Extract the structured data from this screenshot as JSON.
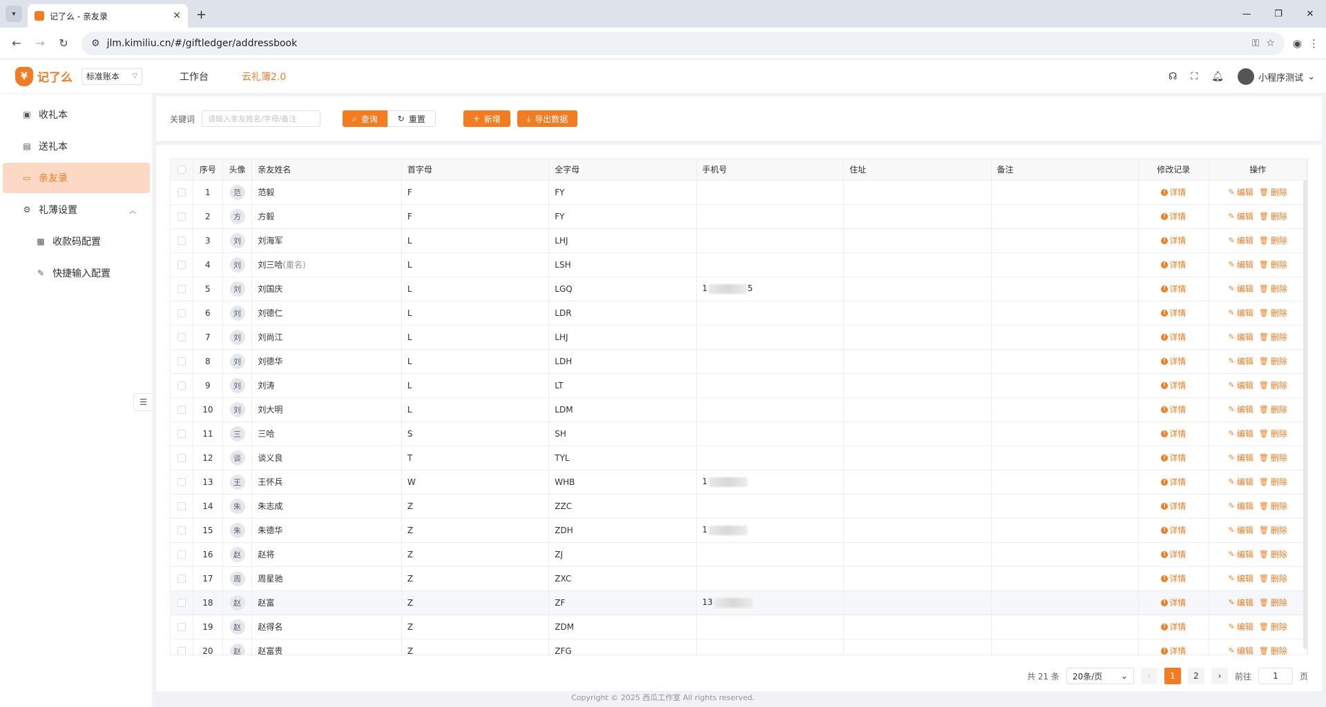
{
  "browser": {
    "tab_title": "记了么 - 亲友录",
    "url": "jlm.kimiliu.cn/#/giftledger/addressbook"
  },
  "app": {
    "logo_text": "记了么",
    "ledger_select": "标准账本",
    "nav": [
      "工作台",
      "云礼簿2.0"
    ],
    "user_name": "小程序测试"
  },
  "sidebar": {
    "items": [
      {
        "label": "收礼本",
        "icon": "book-icon"
      },
      {
        "label": "送礼本",
        "icon": "book-icon"
      },
      {
        "label": "亲友录",
        "icon": "folder-icon"
      },
      {
        "label": "礼薄设置",
        "icon": "gear-icon"
      },
      {
        "label": "收款码配置",
        "icon": "qrcode-icon"
      },
      {
        "label": "快捷输入配置",
        "icon": "edit-icon"
      }
    ]
  },
  "search": {
    "keyword_label": "关键词",
    "keyword_placeholder": "请输入亲友姓名/字母/备注",
    "query_btn": "查询",
    "reset_btn": "重置",
    "add_btn": "新增",
    "export_btn": "导出数据"
  },
  "table": {
    "headers": [
      "序号",
      "头像",
      "亲友姓名",
      "首字母",
      "全字母",
      "手机号",
      "住址",
      "备注",
      "修改记录",
      "操作"
    ],
    "detail_label": "详情",
    "edit_label": "编辑",
    "delete_label": "删除",
    "rows": [
      {
        "no": "1",
        "avatar": "范",
        "name": "范毅",
        "dup": "",
        "initial": "F",
        "full": "FY",
        "phone": ""
      },
      {
        "no": "2",
        "avatar": "方",
        "name": "方毅",
        "dup": "",
        "initial": "F",
        "full": "FY",
        "phone": ""
      },
      {
        "no": "3",
        "avatar": "刘",
        "name": "刘海军",
        "dup": "",
        "initial": "L",
        "full": "LHJ",
        "phone": ""
      },
      {
        "no": "4",
        "avatar": "刘",
        "name": "刘三哈",
        "dup": "(重名)",
        "initial": "L",
        "full": "LSH",
        "phone": ""
      },
      {
        "no": "5",
        "avatar": "刘",
        "name": "刘国庆",
        "dup": "",
        "initial": "L",
        "full": "LGQ",
        "phone": "1",
        "phone_tail": "5"
      },
      {
        "no": "6",
        "avatar": "刘",
        "name": "刘德仁",
        "dup": "",
        "initial": "L",
        "full": "LDR",
        "phone": ""
      },
      {
        "no": "7",
        "avatar": "刘",
        "name": "刘尚江",
        "dup": "",
        "initial": "L",
        "full": "LHJ",
        "phone": ""
      },
      {
        "no": "8",
        "avatar": "刘",
        "name": "刘德华",
        "dup": "",
        "initial": "L",
        "full": "LDH",
        "phone": ""
      },
      {
        "no": "9",
        "avatar": "刘",
        "name": "刘涛",
        "dup": "",
        "initial": "L",
        "full": "LT",
        "phone": ""
      },
      {
        "no": "10",
        "avatar": "刘",
        "name": "刘大明",
        "dup": "",
        "initial": "L",
        "full": "LDM",
        "phone": ""
      },
      {
        "no": "11",
        "avatar": "三",
        "name": "三哈",
        "dup": "",
        "initial": "S",
        "full": "SH",
        "phone": ""
      },
      {
        "no": "12",
        "avatar": "谈",
        "name": "谈义良",
        "dup": "",
        "initial": "T",
        "full": "TYL",
        "phone": ""
      },
      {
        "no": "13",
        "avatar": "王",
        "name": "王怀兵",
        "dup": "",
        "initial": "W",
        "full": "WHB",
        "phone": "1",
        "phone_tail": ""
      },
      {
        "no": "14",
        "avatar": "朱",
        "name": "朱志成",
        "dup": "",
        "initial": "Z",
        "full": "ZZC",
        "phone": ""
      },
      {
        "no": "15",
        "avatar": "朱",
        "name": "朱德华",
        "dup": "",
        "initial": "Z",
        "full": "ZDH",
        "phone": "1",
        "phone_tail": ""
      },
      {
        "no": "16",
        "avatar": "赵",
        "name": "赵将",
        "dup": "",
        "initial": "Z",
        "full": "ZJ",
        "phone": ""
      },
      {
        "no": "17",
        "avatar": "周",
        "name": "周星驰",
        "dup": "",
        "initial": "Z",
        "full": "ZXC",
        "phone": ""
      },
      {
        "no": "18",
        "avatar": "赵",
        "name": "赵富",
        "dup": "",
        "initial": "Z",
        "full": "ZF",
        "phone": "13",
        "phone_tail": ""
      },
      {
        "no": "19",
        "avatar": "赵",
        "name": "赵得名",
        "dup": "",
        "initial": "Z",
        "full": "ZDM",
        "phone": ""
      },
      {
        "no": "20",
        "avatar": "赵",
        "name": "赵富贵",
        "dup": "",
        "initial": "Z",
        "full": "ZFG",
        "phone": ""
      }
    ]
  },
  "pagination": {
    "total": "共 21 条",
    "page_size": "20条/页",
    "pages": [
      "1",
      "2"
    ],
    "current": "1",
    "goto_label": "前往",
    "goto_value": "1",
    "page_suffix": "页"
  },
  "footer": "Copyright © 2025 西瓜工作室 All rights reserved."
}
